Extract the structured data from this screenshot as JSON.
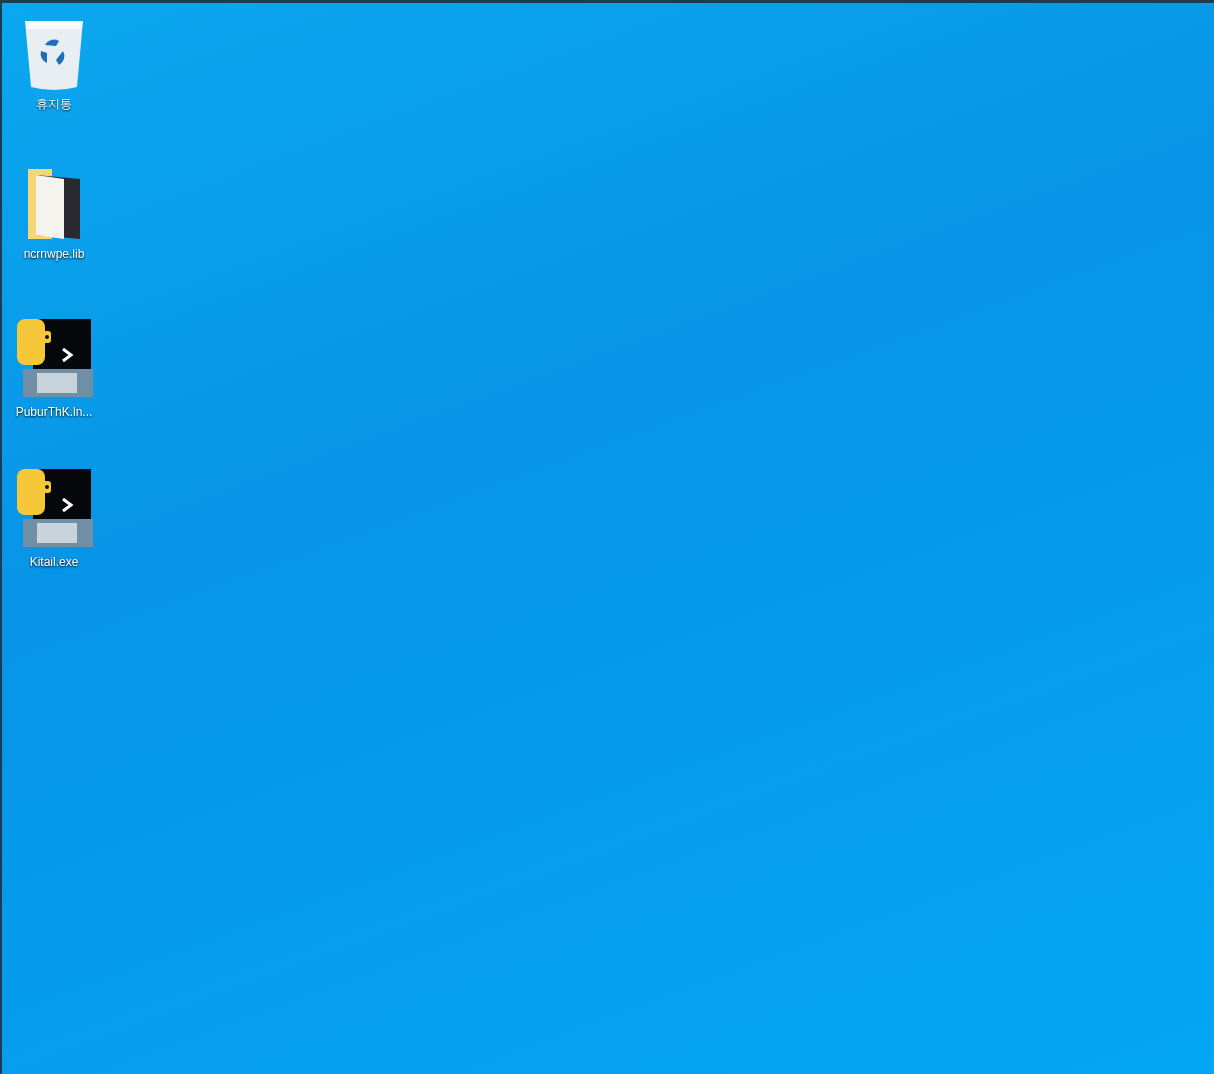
{
  "desktop_icons": [
    {
      "kind": "recycle-bin",
      "label": "휴지통"
    },
    {
      "kind": "folder",
      "label": "ncrnwpe.lib"
    },
    {
      "kind": "python",
      "label": "PuburThK.ln..."
    },
    {
      "kind": "python",
      "label": "Kitail.exe"
    }
  ]
}
